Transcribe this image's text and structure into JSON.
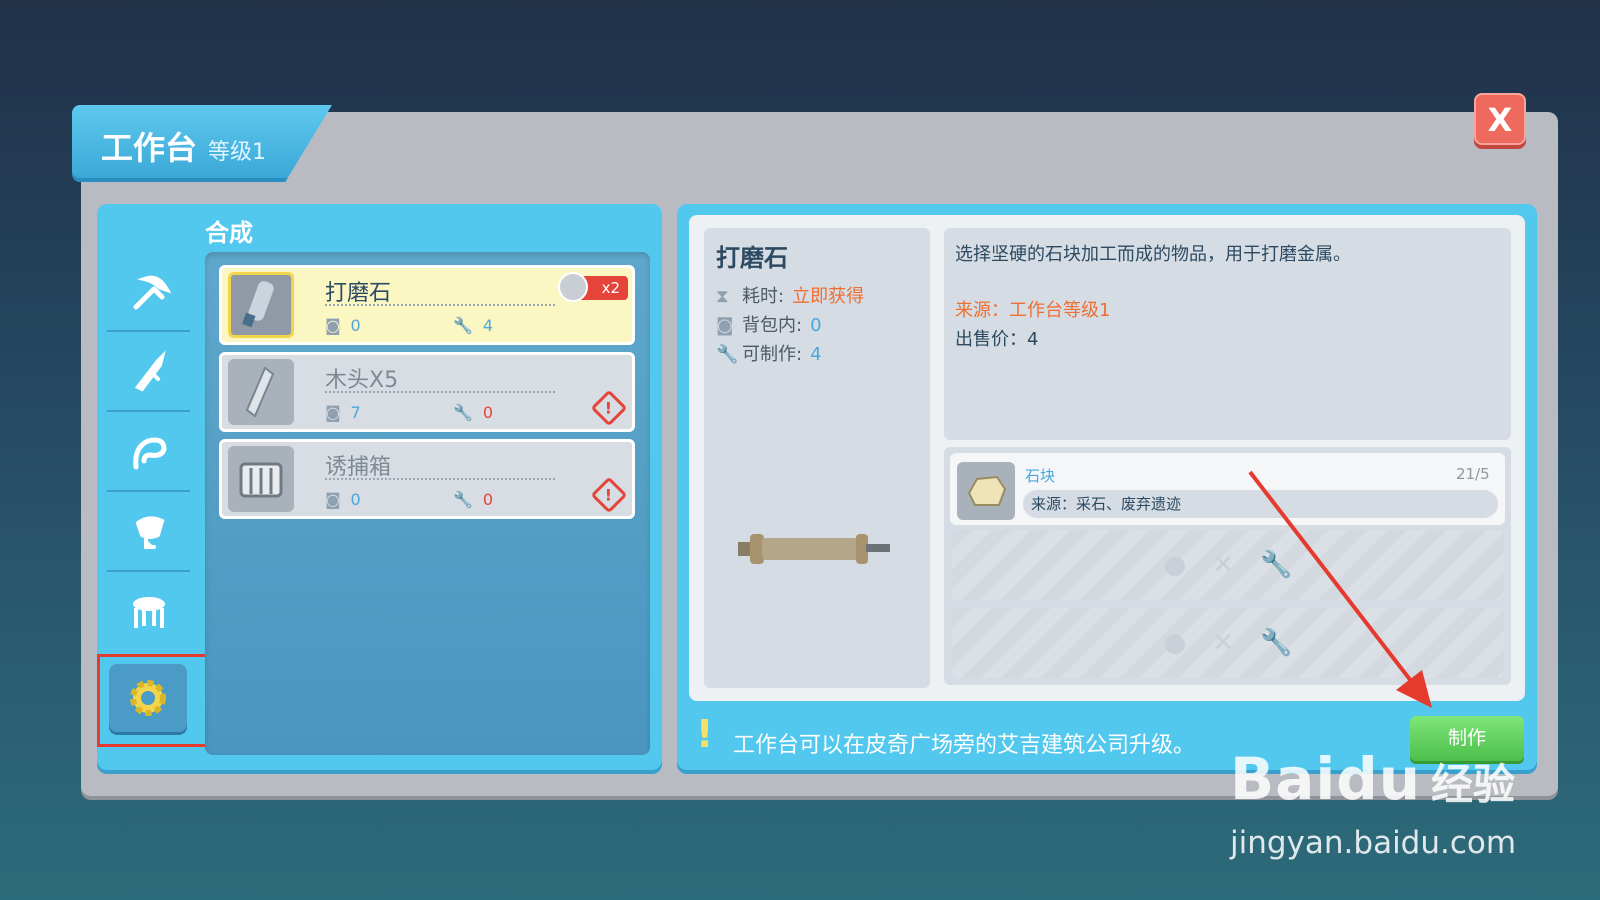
{
  "window": {
    "title": "工作台",
    "level": "等级1",
    "close_label": "X"
  },
  "left": {
    "section_title": "合成",
    "sidebar": [
      {
        "icon": "pickaxe-icon"
      },
      {
        "icon": "sword-icon"
      },
      {
        "icon": "snare-icon"
      },
      {
        "icon": "lamp-icon"
      },
      {
        "icon": "furniture-icon"
      },
      {
        "icon": "gear-icon"
      }
    ],
    "recipes": [
      {
        "name": "打磨石",
        "bag": "0",
        "makeable": "4",
        "badge": "x2"
      },
      {
        "name": "木头X5",
        "bag": "7",
        "makeable": "0",
        "warning": "!"
      },
      {
        "name": "诱捕箱",
        "bag": "0",
        "makeable": "0",
        "warning": "!"
      }
    ]
  },
  "detail": {
    "name": "打磨石",
    "time_label": "耗时:",
    "time_value": "立即获得",
    "bag_label": "背包内:",
    "bag_value": "0",
    "make_label": "可制作:",
    "make_value": "4",
    "description": "选择坚硬的石块加工而成的物品，用于打磨金属。",
    "source": "来源：工作台等级1",
    "price": "出售价：4"
  },
  "materials": [
    {
      "name": "石块",
      "count": "21/5",
      "source": "来源：采石、废弃遗迹"
    }
  ],
  "tip": {
    "icon": "!",
    "text": "工作台可以在皮奇广场旁的艾吉建筑公司升级。"
  },
  "make_button": "制作",
  "watermark": {
    "logo": "Bai",
    "logo_paw": "du",
    "logo_cn": "经验",
    "url": "jingyan.baidu.com"
  },
  "colors": {
    "accent": "#53c8ee",
    "warning": "#e5443a",
    "orange": "#ef6e32",
    "green": "#4ebe4b"
  }
}
